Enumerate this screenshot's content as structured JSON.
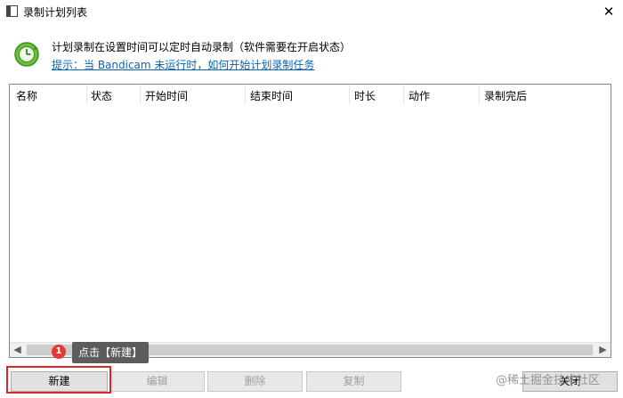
{
  "window": {
    "title": "录制计划列表",
    "close_glyph": "✕"
  },
  "info": {
    "description": "计划录制在设置时间可以定时自动录制（软件需要在开启状态）",
    "hint_link": "提示：当 Bandicam 未运行时，如何开始计划录制任务"
  },
  "list": {
    "columns": [
      "名称",
      "状态",
      "开始时间",
      "结束时间",
      "时长",
      "动作",
      "录制完后"
    ]
  },
  "buttons": {
    "new": "新建",
    "edit": "编辑",
    "delete": "删除",
    "copy": "复制",
    "close": "关闭"
  },
  "annotation": {
    "badge": "1",
    "tooltip": "点击【新建】"
  },
  "watermark": "@稀土掘金技术社区",
  "colors": {
    "link": "#0a64b4",
    "highlight": "#e02525",
    "badge": "#e53935"
  }
}
